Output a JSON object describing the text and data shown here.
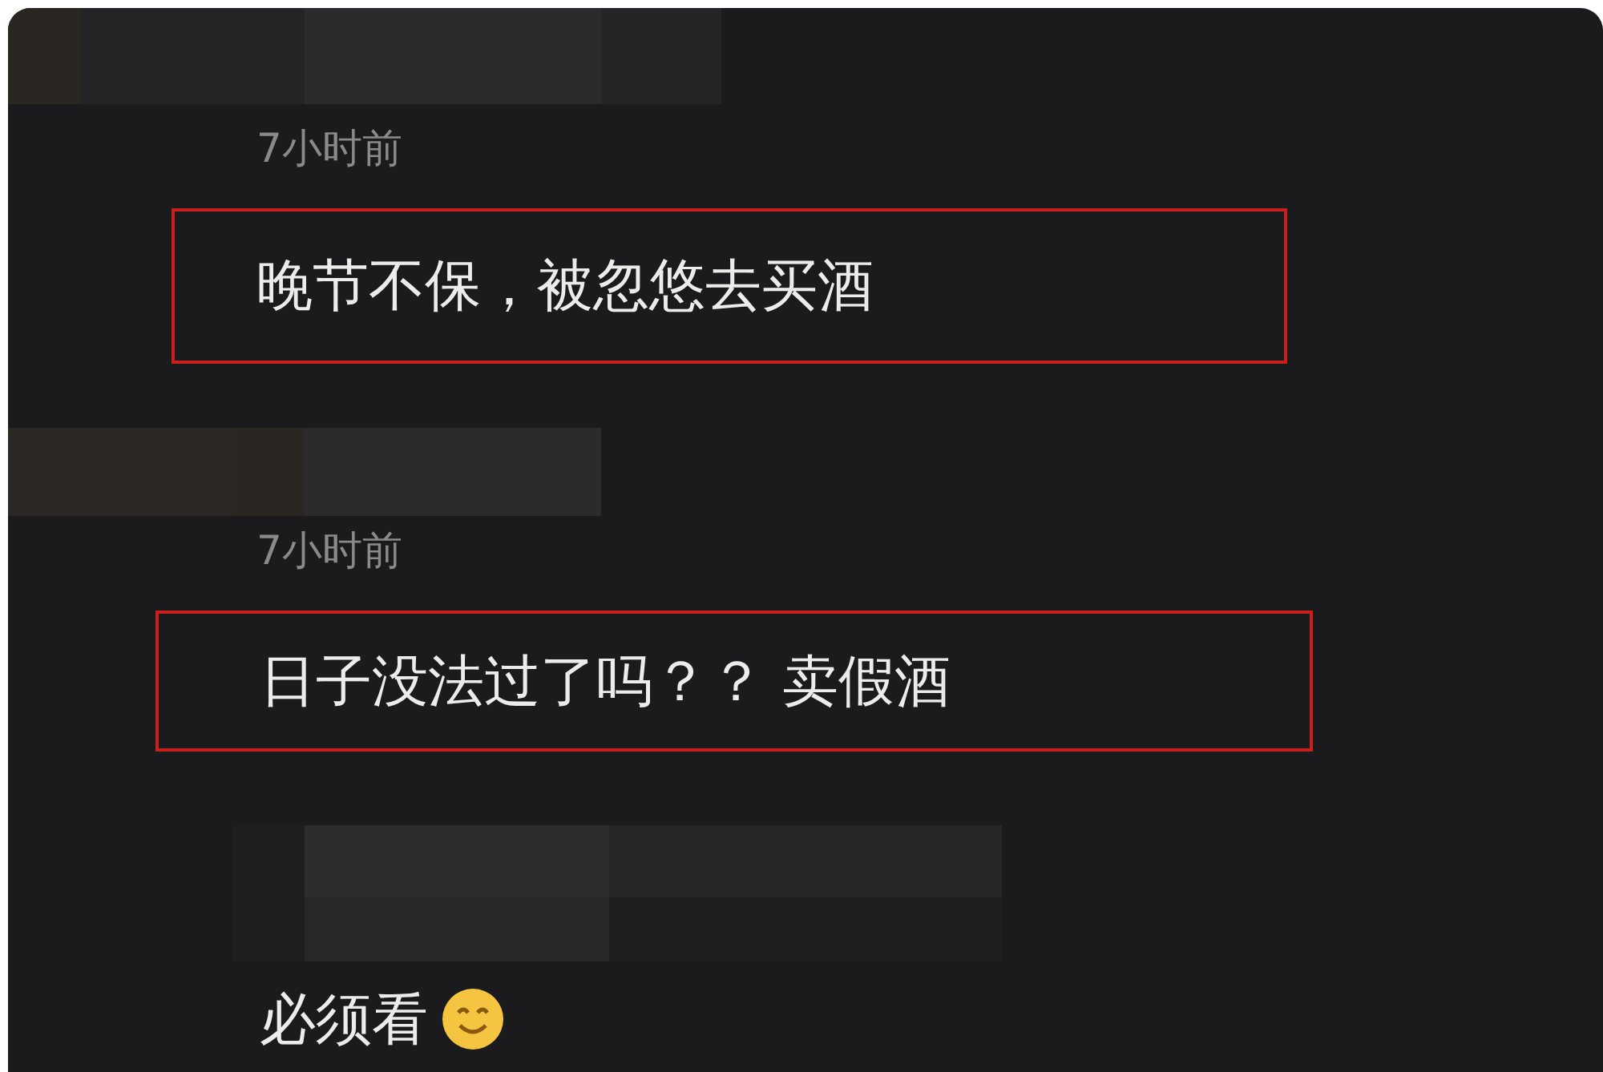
{
  "comments": [
    {
      "time": "7小时前",
      "text": "晚节不保，被忽悠去买酒",
      "highlighted": true,
      "emoji": false
    },
    {
      "time": "7小时前",
      "text": "日子没法过了吗？？ 卖假酒",
      "highlighted": true,
      "emoji": false
    },
    {
      "text": "必须看",
      "highlighted": false,
      "emoji": true
    }
  ]
}
